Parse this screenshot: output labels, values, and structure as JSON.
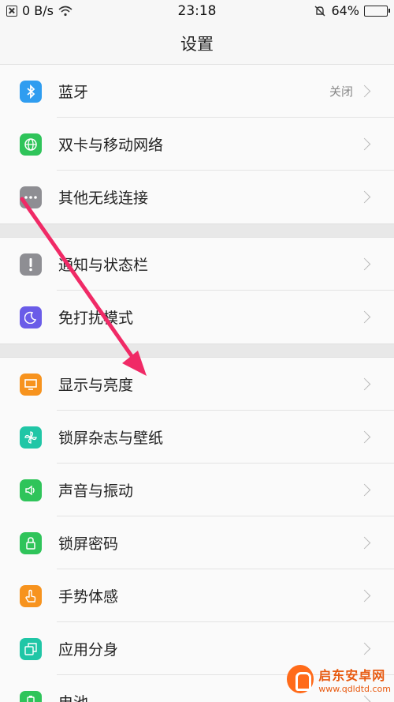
{
  "status_bar": {
    "net_speed": "0 B/s",
    "time": "23:18",
    "battery": "64%",
    "battery_level": 0.64
  },
  "title": "设置",
  "groups": [
    [
      {
        "name": "bluetooth",
        "icon": "bluetooth-icon",
        "color": "#2f9df0",
        "label": "蓝牙",
        "value": "关闭"
      },
      {
        "name": "dual-sim",
        "icon": "globe-icon",
        "color": "#2fc45a",
        "label": "双卡与移动网络",
        "value": ""
      },
      {
        "name": "other-wireless",
        "icon": "more-dots-icon",
        "color": "#8e8e93",
        "label": "其他无线连接",
        "value": ""
      }
    ],
    [
      {
        "name": "notifications",
        "icon": "exclamation-icon",
        "color": "#8e8e93",
        "label": "通知与状态栏",
        "value": ""
      },
      {
        "name": "do-not-disturb",
        "icon": "moon-icon",
        "color": "#6a5ce8",
        "label": "免打扰模式",
        "value": ""
      }
    ],
    [
      {
        "name": "display",
        "icon": "monitor-icon",
        "color": "#f7931e",
        "label": "显示与亮度",
        "value": ""
      },
      {
        "name": "lockscreen-wallpaper",
        "icon": "pinwheel-icon",
        "color": "#20c6a6",
        "label": "锁屏杂志与壁纸",
        "value": ""
      },
      {
        "name": "sound",
        "icon": "speaker-icon",
        "color": "#2fc45a",
        "label": "声音与振动",
        "value": ""
      },
      {
        "name": "lockscreen-password",
        "icon": "lock-icon",
        "color": "#2fc45a",
        "label": "锁屏密码",
        "value": ""
      },
      {
        "name": "gestures",
        "icon": "hand-icon",
        "color": "#f7931e",
        "label": "手势体感",
        "value": ""
      },
      {
        "name": "app-clone",
        "icon": "clone-icon",
        "color": "#20c6a6",
        "label": "应用分身",
        "value": ""
      },
      {
        "name": "battery",
        "icon": "battery-icon",
        "color": "#2fc45a",
        "label": "电池",
        "value": ""
      }
    ]
  ],
  "watermark": {
    "name": "启东安卓网",
    "url": "www.qdldtd.com"
  }
}
